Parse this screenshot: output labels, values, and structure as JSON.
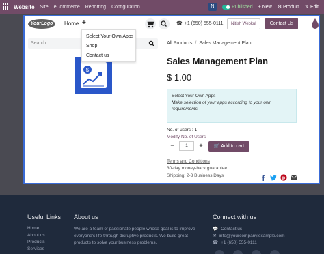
{
  "topbar": {
    "brand": "Website",
    "menus": [
      "Site",
      "eCommerce",
      "Reporting",
      "Configuration"
    ],
    "user_initial": "N",
    "published_label": "Published",
    "new_label": "+ New",
    "product_label": "Product",
    "edit_label": "Edit"
  },
  "header": {
    "logo_text": "YourLogo",
    "nav_home": "Home",
    "nav_plus": "+",
    "phone": "+1 (650) 555-0111",
    "user_name": "Nitish Webkul",
    "contact_button": "Contact Us"
  },
  "dropdown": {
    "items": [
      "Select Your Own Apps",
      "Shop",
      "Contact us"
    ]
  },
  "search": {
    "placeholder": "Search..."
  },
  "breadcrumb": {
    "parent": "All Products",
    "separator": "/",
    "current": "Sales Management Plan"
  },
  "product": {
    "title": "Sales Management Plan",
    "price": "$ 1.00",
    "info_title": "Select Your Own Apps",
    "info_text": "Make selection of your apps according to your own requirements.",
    "users_label": "No. of users : 1",
    "modify_label": "Modify No. of Users",
    "quantity": "1",
    "qty_minus": "−",
    "qty_plus": "+",
    "add_to_cart": "Add to cart",
    "terms": "Terms and Conditions",
    "guarantee": "30-day money-back guarantee",
    "shipping": "Shipping: 2-3 Business Days"
  },
  "footer": {
    "useful_links_title": "Useful Links",
    "links": [
      "Home",
      "About us",
      "Products",
      "Services"
    ],
    "about_title": "About us",
    "about_text": "We are a team of passionate people whose goal is to improve everyone's life through disruptive products. We build great products to solve your business problems.",
    "connect_title": "Connect with us",
    "contact_us": "Contact us",
    "email": "info@yourcompany.example.com",
    "phone": "+1 (650) 555-0111"
  },
  "colors": {
    "brand": "#714B67",
    "topbar": "#714B67",
    "footer": "#1f2a3c",
    "frame_border": "#3a6bd6",
    "info_bg": "#e3f4f6"
  },
  "icons": [
    "apps-grid-icon",
    "cart-icon",
    "search-icon",
    "phone-icon",
    "drop-icon",
    "magnifier-icon",
    "product-chart-icon",
    "cart-add-icon",
    "facebook-icon",
    "twitter-icon",
    "pinterest-icon",
    "email-icon",
    "comment-icon",
    "envelope-icon",
    "phone-footer-icon"
  ]
}
